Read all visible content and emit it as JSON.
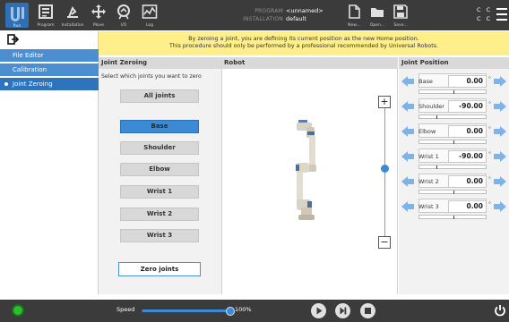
{
  "topbar": {
    "nav": [
      {
        "label": "Run",
        "icon": "run-icon"
      },
      {
        "label": "Program",
        "icon": "program-icon"
      },
      {
        "label": "Installation",
        "icon": "installation-icon"
      },
      {
        "label": "Move",
        "icon": "move-icon"
      },
      {
        "label": "I/O",
        "icon": "io-icon"
      },
      {
        "label": "Log",
        "icon": "log-icon"
      }
    ],
    "program_key": "PROGRAM",
    "program_value": "<unnamed>",
    "installation_key": "INSTALLATION",
    "installation_value": "default",
    "file_actions": [
      {
        "label": "New...",
        "icon": "new-file-icon"
      },
      {
        "label": "Open...",
        "icon": "open-folder-icon"
      },
      {
        "label": "Save...",
        "icon": "save-icon"
      }
    ],
    "cc_top": "C C",
    "cc_bottom": "C C"
  },
  "sidebar": {
    "items": [
      {
        "label": "File Editor",
        "selected": false
      },
      {
        "label": "Calibration",
        "selected": false
      },
      {
        "label": "Joint Zeroing",
        "selected": true
      }
    ]
  },
  "banner": {
    "line1": "By zeroing a joint, you are defining its current position as the new Home position.",
    "line2": "This procedure should only be performed by a professional recommended by Universal Robots."
  },
  "joint_zeroing": {
    "header": "Joint Zeroing",
    "instruction": "Select which joints you want to zero",
    "all_joints": "All joints",
    "joints": [
      "Base",
      "Shoulder",
      "Elbow",
      "Wrist 1",
      "Wrist 2",
      "Wrist 3"
    ],
    "selected_joint": "Base",
    "zero_button": "Zero joints"
  },
  "robot": {
    "header": "Robot",
    "zoom_in": "+",
    "zoom_out": "−"
  },
  "joint_position": {
    "header": "Joint Position",
    "unit": "°",
    "rows": [
      {
        "name": "Base",
        "value": "0.00",
        "slider_fraction": 0.5
      },
      {
        "name": "Shoulder",
        "value": "-90.00",
        "slider_fraction": 0.25
      },
      {
        "name": "Elbow",
        "value": "0.00",
        "slider_fraction": 0.5
      },
      {
        "name": "Wrist 1",
        "value": "-90.00",
        "slider_fraction": 0.25
      },
      {
        "name": "Wrist 2",
        "value": "0.00",
        "slider_fraction": 0.5
      },
      {
        "name": "Wrist 3",
        "value": "0.00",
        "slider_fraction": 0.5
      }
    ]
  },
  "bottombar": {
    "speed_label": "Speed",
    "speed_percent": 100,
    "speed_text": "100%",
    "colors": {
      "accent": "#3b8ad6",
      "power_on": "#27c22b",
      "bar": "#3b3b3b",
      "banner": "#ffef8a"
    }
  }
}
